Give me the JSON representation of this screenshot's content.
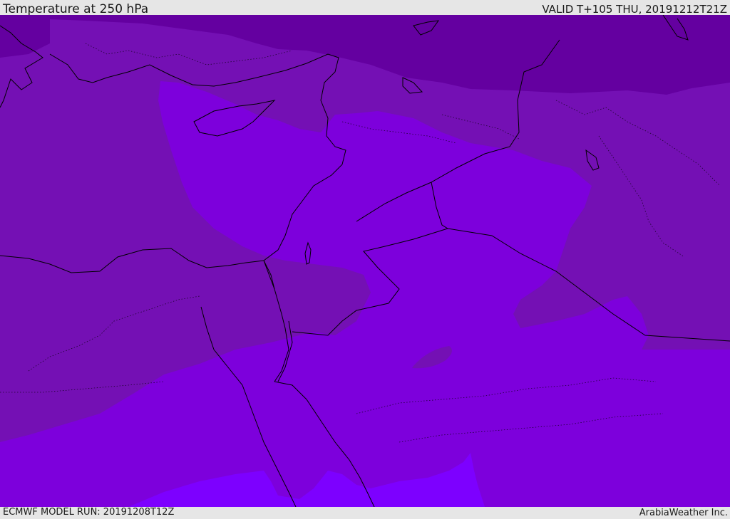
{
  "header": {
    "title": "Temperature at 250 hPa",
    "valid_time": "VALID T+105 THU, 20191212T21Z"
  },
  "footer": {
    "model_run": "ECMWF MODEL RUN: 20191208T12Z",
    "credit": "ArabiaWeather Inc."
  },
  "map": {
    "field": "temperature",
    "pressure_level": "250 hPa",
    "colors": {
      "darkest_band": "#6400a0",
      "dark_band": "#7410b4",
      "mid_band": "#7d00dc",
      "light_band": "#7d00ff",
      "coastline": "#000000"
    }
  }
}
